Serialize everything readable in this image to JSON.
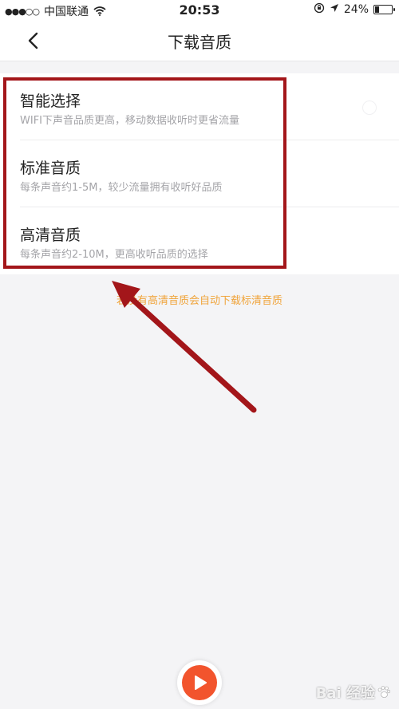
{
  "status_bar": {
    "signal": "●●●○○",
    "carrier": "中国联通",
    "time": "20:53",
    "battery": "24%",
    "battery_level": 0.24
  },
  "nav": {
    "title": "下载音质",
    "back_icon": "chevron-left-icon"
  },
  "options": [
    {
      "title": "智能选择",
      "desc": "WIFI下声音品质更高，移动数据收听时更省流量"
    },
    {
      "title": "标准音质",
      "desc": "每条声音约1-5M，较少流量拥有收听好品质"
    },
    {
      "title": "高清音质",
      "desc": "每条声音约2-10M，更高收听品质的选择"
    }
  ],
  "notice": "若没有高清音质会自动下载标清音质",
  "colors": {
    "accent": "#f2542d",
    "notice": "#f0a43b",
    "annotation": "#a3161a"
  },
  "watermark": {
    "text": "Bai 经验"
  }
}
